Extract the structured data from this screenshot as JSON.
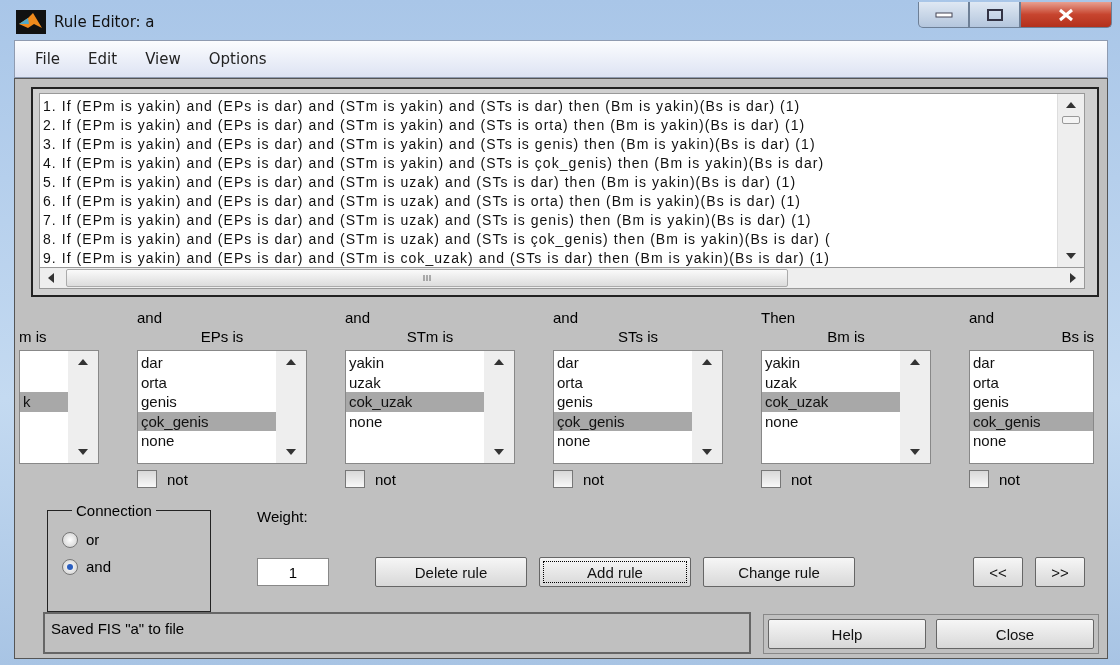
{
  "window": {
    "title": "Rule Editor: a"
  },
  "menu": [
    "File",
    "Edit",
    "View",
    "Options"
  ],
  "rules": [
    "1. If (EPm is yakin) and (EPs is dar) and (STm is yakin) and (STs is dar) then (Bm is yakin)(Bs is dar) (1)",
    "2. If (EPm is yakin) and (EPs is dar) and (STm is yakin) and (STs is orta) then (Bm is yakin)(Bs is dar) (1)",
    "3. If (EPm is yakin) and (EPs is dar) and (STm is yakin) and (STs is genis) then (Bm is yakin)(Bs is dar) (1)",
    "4. If (EPm is yakin) and (EPs is dar) and (STm is yakin) and (STs is çok_genis) then (Bm is yakin)(Bs is dar)",
    "5. If (EPm is yakin) and (EPs is dar) and (STm is uzak) and (STs is dar) then (Bm is yakin)(Bs is dar) (1)",
    "6. If (EPm is yakin) and (EPs is dar) and (STm is uzak) and (STs is orta) then (Bm is yakin)(Bs is dar) (1)",
    "7. If (EPm is yakin) and (EPs is dar) and (STm is uzak) and (STs is genis) then (Bm is yakin)(Bs is dar) (1)",
    "8. If (EPm is yakin) and (EPs is dar) and (STm is uzak) and (STs is çok_genis) then (Bm is yakin)(Bs is dar) (",
    "9. If (EPm is yakin) and (EPs is dar) and (STm is cok_uzak) and (STs is dar) then (Bm is yakin)(Bs is dar) (1)"
  ],
  "columns": [
    {
      "kind": "partial_left",
      "header": "m is",
      "items": [
        {
          "selected": false
        },
        {
          "selected": false
        },
        {
          "text": "k",
          "selected": true
        }
      ]
    },
    {
      "connective": "and",
      "header": "EPs is",
      "items": [
        {
          "text": "dar",
          "selected": false
        },
        {
          "text": "orta",
          "selected": false
        },
        {
          "text": "genis",
          "selected": false
        },
        {
          "text": "çok_genis",
          "selected": true
        },
        {
          "text": "none",
          "selected": false
        }
      ],
      "not": {
        "label": "not",
        "checked": false
      }
    },
    {
      "connective": "and",
      "header": "STm is",
      "items": [
        {
          "text": "yakin",
          "selected": false
        },
        {
          "text": "uzak",
          "selected": false
        },
        {
          "text": "cok_uzak",
          "selected": true
        },
        {
          "text": "none",
          "selected": false
        }
      ],
      "not": {
        "label": "not",
        "checked": false
      }
    },
    {
      "connective": "and",
      "header": "STs is",
      "items": [
        {
          "text": "dar",
          "selected": false
        },
        {
          "text": "orta",
          "selected": false
        },
        {
          "text": "genis",
          "selected": false
        },
        {
          "text": "çok_genis",
          "selected": true
        },
        {
          "text": "none",
          "selected": false
        }
      ],
      "not": {
        "label": "not",
        "checked": false
      }
    },
    {
      "connective": "Then",
      "header": "Bm is",
      "items": [
        {
          "text": "yakin",
          "selected": false
        },
        {
          "text": "uzak",
          "selected": false
        },
        {
          "text": "cok_uzak",
          "selected": true
        },
        {
          "text": "none",
          "selected": false
        }
      ],
      "not": {
        "label": "not",
        "checked": false
      }
    },
    {
      "kind": "partial_right",
      "connective": "and",
      "header": "Bs is",
      "items": [
        {
          "text": "dar",
          "selected": false
        },
        {
          "text": "orta",
          "selected": false
        },
        {
          "text": "genis",
          "selected": false
        },
        {
          "text": "cok_genis",
          "selected": true
        },
        {
          "text": "none",
          "selected": false
        }
      ],
      "not": {
        "label": "not",
        "checked": false
      }
    }
  ],
  "connection": {
    "title": "Connection",
    "options": [
      {
        "label": "or",
        "selected": false
      },
      {
        "label": "and",
        "selected": true
      }
    ]
  },
  "weight": {
    "label": "Weight:",
    "value": "1"
  },
  "rule_buttons": [
    "Delete rule",
    "Add rule",
    "Change rule"
  ],
  "nav_buttons": [
    "<<",
    ">>"
  ],
  "status": "Saved FIS \"a\" to file",
  "footer_buttons": [
    "Help",
    "Close"
  ]
}
